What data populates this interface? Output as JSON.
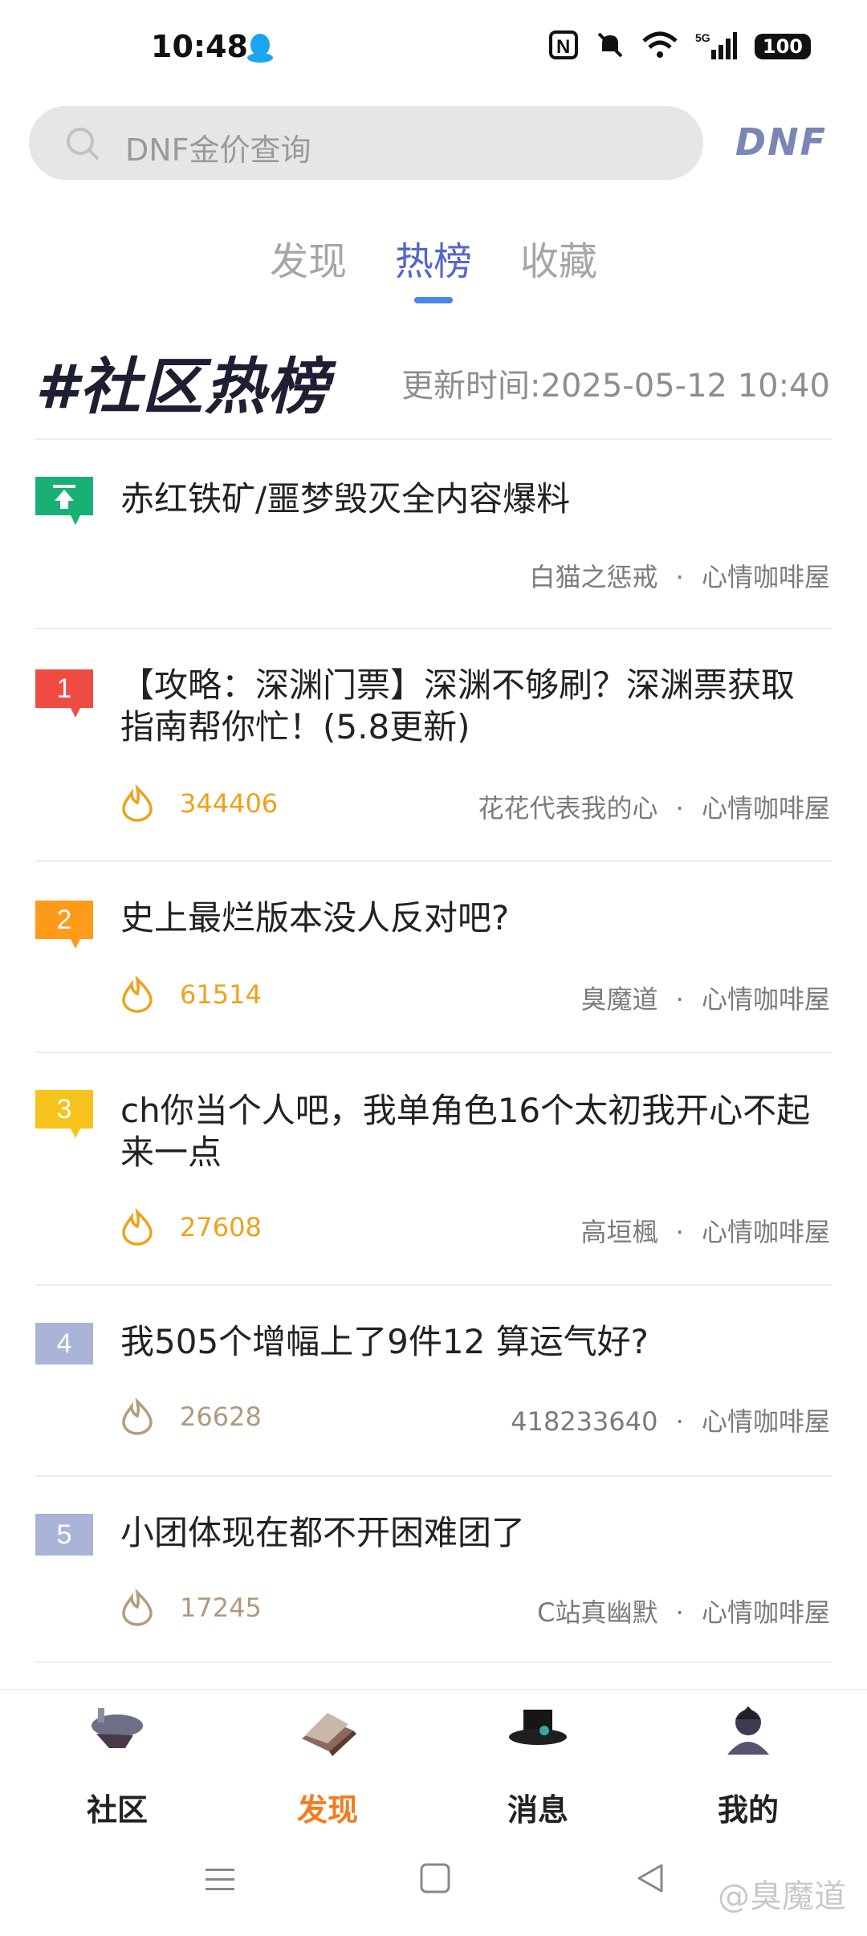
{
  "status": {
    "time": "10:48",
    "battery": "100",
    "network": "5G"
  },
  "search": {
    "placeholder": "DNF金价查询",
    "logo": "DNF"
  },
  "tabs": [
    {
      "label": "发现"
    },
    {
      "label": "热榜"
    },
    {
      "label": "收藏"
    }
  ],
  "tabs_active_index": 1,
  "hot": {
    "heading": "#社区热榜",
    "update": "更新时间:2025-05-12 10:40"
  },
  "rows": [
    {
      "badge": "",
      "title": "赤红铁矿/噩梦毁灭全内容爆料",
      "heat": "",
      "author": "白猫之惩戒",
      "board": "心情咖啡屋",
      "badge_color": "#19b173"
    },
    {
      "badge": "1",
      "title": "【攻略：深渊门票】深渊不够刷？深渊票获取指南帮你忙！(5.8更新)",
      "heat": "344406",
      "author": "花花代表我的心",
      "board": "心情咖啡屋",
      "badge_color": "#ef4b43"
    },
    {
      "badge": "2",
      "title": "史上最烂版本没人反对吧?",
      "heat": "61514",
      "author": "臭魔道",
      "board": "心情咖啡屋",
      "badge_color": "#ff9a1a"
    },
    {
      "badge": "3",
      "title": "ch你当个人吧，我单角色16个太初我开心不起来一点",
      "heat": "27608",
      "author": "高垣楓",
      "board": "心情咖啡屋",
      "badge_color": "#f6c21c"
    },
    {
      "badge": "4",
      "title": "我505个增幅上了9件12 算运气好?",
      "heat": "26628",
      "author": "418233640",
      "board": "心情咖啡屋",
      "badge_color": "#aab3d8"
    },
    {
      "badge": "5",
      "title": "小团体现在都不开困难团了",
      "heat": "17245",
      "author": "C站真幽默",
      "board": "心情咖啡屋",
      "badge_color": "#aab3d8"
    }
  ],
  "meta_sep": "·",
  "nav": [
    {
      "label": "社区"
    },
    {
      "label": "发现"
    },
    {
      "label": "消息"
    },
    {
      "label": "我的"
    }
  ],
  "nav_active_index": 1,
  "watermark": "@臭魔道"
}
